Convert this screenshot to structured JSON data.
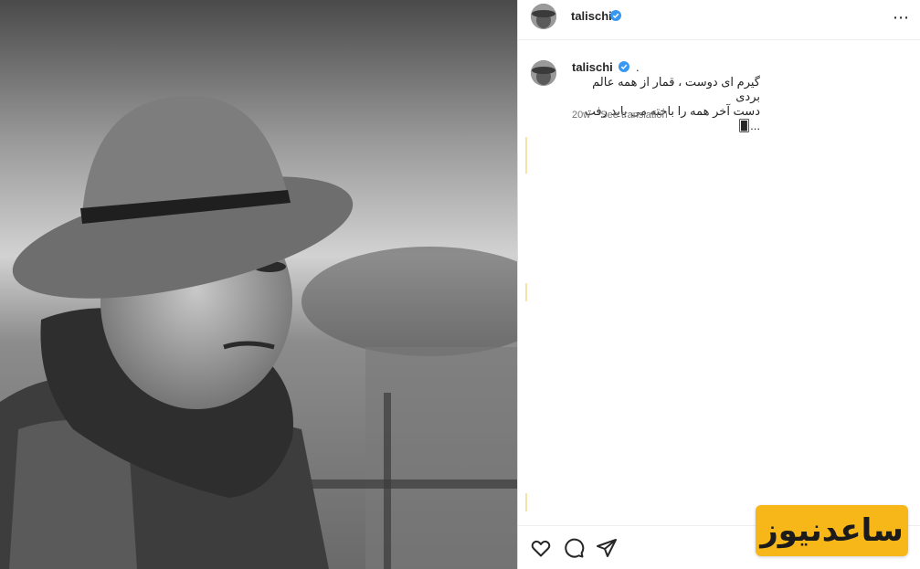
{
  "post": {
    "username": "talischi",
    "caption_prefix": ".",
    "caption_lines": [
      "گیرم ای دوست ، قمار از همه عالم بردی",
      "دست آخر همه را باخته می باید رفت ...🂠"
    ],
    "age": "20w",
    "see_translation": "See translation"
  },
  "header": {
    "username": "talischi",
    "more_icon": "more-horizontal-icon"
  },
  "actions": {
    "icons": [
      "heart-icon",
      "comment-icon",
      "share-icon"
    ]
  },
  "watermark": {
    "text": "ساعدنیوز"
  },
  "colors": {
    "verified": "#3897f0",
    "watermark_bg": "#f7b719",
    "text": "#262626",
    "muted": "#737373"
  }
}
